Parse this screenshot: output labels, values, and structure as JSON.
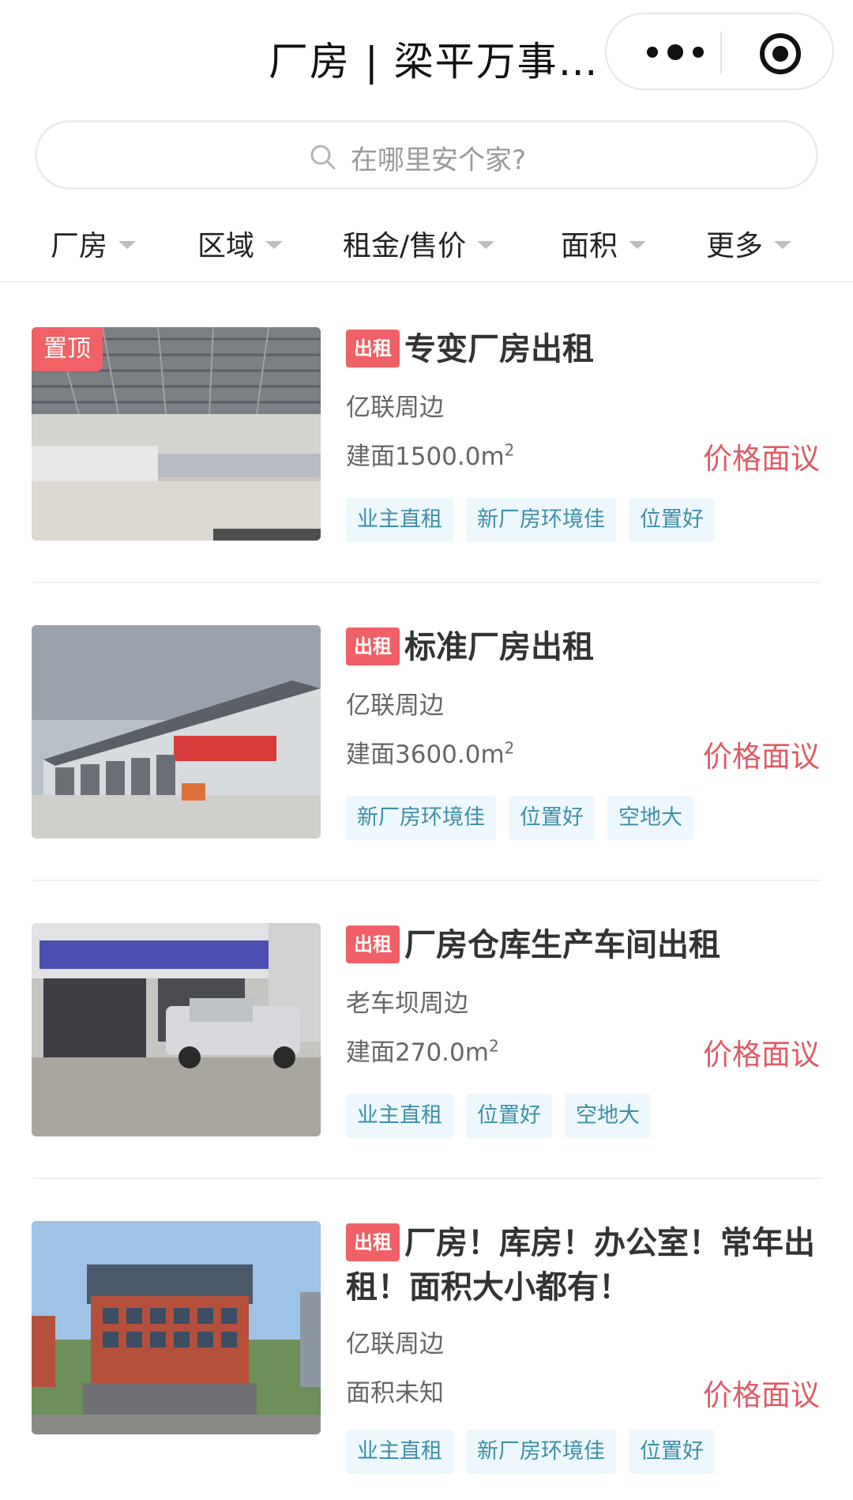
{
  "header": {
    "title": "厂房 | 梁平万事…",
    "more_icon": "more-dots-icon",
    "close_icon": "target-icon"
  },
  "search": {
    "placeholder": "在哪里安个家?",
    "icon": "search-icon"
  },
  "filters": [
    {
      "label": "厂房"
    },
    {
      "label": "区域"
    },
    {
      "label": "租金/售价"
    },
    {
      "label": "面积"
    },
    {
      "label": "更多"
    }
  ],
  "listings": [
    {
      "pin": "置顶",
      "badge": "出租",
      "title": "专变厂房出租",
      "location": "亿联周边",
      "area": "建面1500.0m",
      "area_sup": "2",
      "price": "价格面议",
      "tags": [
        "业主直租",
        "新厂房环境佳",
        "位置好"
      ]
    },
    {
      "badge": "出租",
      "title": "标准厂房出租",
      "location": "亿联周边",
      "area": "建面3600.0m",
      "area_sup": "2",
      "price": "价格面议",
      "tags": [
        "新厂房环境佳",
        "位置好",
        "空地大"
      ]
    },
    {
      "badge": "出租",
      "title": "厂房仓库生产车间出租",
      "location": "老车坝周边",
      "area": "建面270.0m",
      "area_sup": "2",
      "price": "价格面议",
      "tags": [
        "业主直租",
        "位置好",
        "空地大"
      ]
    },
    {
      "badge": "出租",
      "title": "厂房！库房！办公室！常年出租！面积大小都有！",
      "location": "亿联周边",
      "area": "面积未知",
      "price": "价格面议",
      "tags": [
        "业主直租",
        "新厂房环境佳",
        "位置好"
      ]
    }
  ],
  "colors": {
    "accent_red": "#ef6166",
    "price_red": "#e05b66",
    "tag_bg": "#eef8fc",
    "tag_text": "#3d8fa8"
  }
}
